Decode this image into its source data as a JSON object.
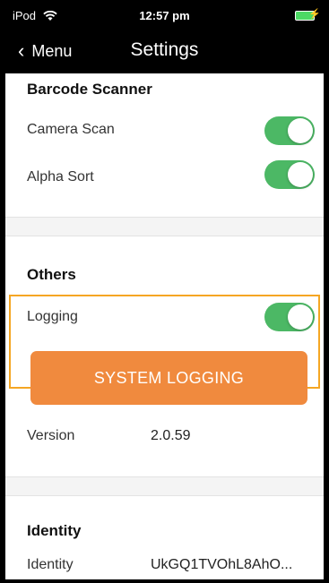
{
  "status_bar": {
    "carrier": "iPod",
    "time": "12:57 pm"
  },
  "nav": {
    "back_label": "Menu",
    "title": "Settings"
  },
  "sections": {
    "barcode": {
      "title": "Barcode Scanner",
      "camera_scan_label": "Camera Scan",
      "camera_scan_on": true,
      "alpha_sort_label": "Alpha Sort",
      "alpha_sort_on": true
    },
    "others": {
      "title": "Others",
      "logging_label": "Logging",
      "logging_on": true,
      "system_logging_button": "SYSTEM LOGGING",
      "version_label": "Version",
      "version_value": "2.0.59"
    },
    "identity": {
      "title": "Identity",
      "identity_label": "Identity",
      "identity_value": "UkGQ1TVOhL8AhO..."
    }
  },
  "colors": {
    "toggle_on": "#4cb865",
    "button": "#f08a3e",
    "highlight": "#f5a623"
  },
  "icons": [
    "wifi-icon",
    "battery-icon",
    "charging-icon",
    "back-chevron-icon"
  ]
}
